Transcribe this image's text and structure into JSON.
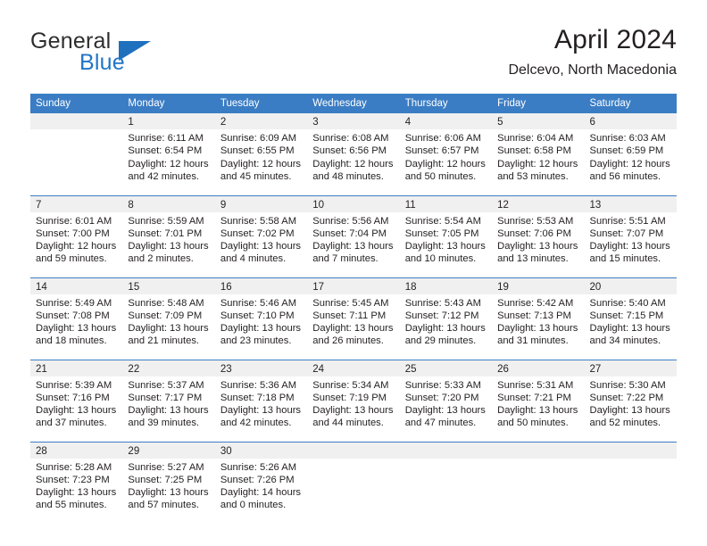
{
  "brand": {
    "name_part1": "General",
    "name_part2": "Blue",
    "triangle_icon": "triangle-icon",
    "colors": {
      "dark": "#2e2e2e",
      "blue": "#2176c7",
      "triangle": "#1f70bd"
    }
  },
  "header": {
    "title": "April 2024",
    "subtitle": "Delcevo, North Macedonia"
  },
  "theme": {
    "header_blue": "#3b7dc4",
    "daynum_band": "#f0f0f0",
    "text": "#231f20",
    "page_background": "#ffffff"
  },
  "calendar": {
    "weekday_headers": [
      "Sunday",
      "Monday",
      "Tuesday",
      "Wednesday",
      "Thursday",
      "Friday",
      "Saturday"
    ],
    "labels": {
      "sunrise": "Sunrise:",
      "sunset": "Sunset:",
      "daylight": "Daylight:"
    },
    "weeks": [
      [
        {
          "day": "",
          "sunrise": "",
          "sunset": "",
          "daylight_line1": "",
          "daylight_line2": ""
        },
        {
          "day": "1",
          "sunrise": "Sunrise: 6:11 AM",
          "sunset": "Sunset: 6:54 PM",
          "daylight_line1": "Daylight: 12 hours",
          "daylight_line2": "and 42 minutes."
        },
        {
          "day": "2",
          "sunrise": "Sunrise: 6:09 AM",
          "sunset": "Sunset: 6:55 PM",
          "daylight_line1": "Daylight: 12 hours",
          "daylight_line2": "and 45 minutes."
        },
        {
          "day": "3",
          "sunrise": "Sunrise: 6:08 AM",
          "sunset": "Sunset: 6:56 PM",
          "daylight_line1": "Daylight: 12 hours",
          "daylight_line2": "and 48 minutes."
        },
        {
          "day": "4",
          "sunrise": "Sunrise: 6:06 AM",
          "sunset": "Sunset: 6:57 PM",
          "daylight_line1": "Daylight: 12 hours",
          "daylight_line2": "and 50 minutes."
        },
        {
          "day": "5",
          "sunrise": "Sunrise: 6:04 AM",
          "sunset": "Sunset: 6:58 PM",
          "daylight_line1": "Daylight: 12 hours",
          "daylight_line2": "and 53 minutes."
        },
        {
          "day": "6",
          "sunrise": "Sunrise: 6:03 AM",
          "sunset": "Sunset: 6:59 PM",
          "daylight_line1": "Daylight: 12 hours",
          "daylight_line2": "and 56 minutes."
        }
      ],
      [
        {
          "day": "7",
          "sunrise": "Sunrise: 6:01 AM",
          "sunset": "Sunset: 7:00 PM",
          "daylight_line1": "Daylight: 12 hours",
          "daylight_line2": "and 59 minutes."
        },
        {
          "day": "8",
          "sunrise": "Sunrise: 5:59 AM",
          "sunset": "Sunset: 7:01 PM",
          "daylight_line1": "Daylight: 13 hours",
          "daylight_line2": "and 2 minutes."
        },
        {
          "day": "9",
          "sunrise": "Sunrise: 5:58 AM",
          "sunset": "Sunset: 7:02 PM",
          "daylight_line1": "Daylight: 13 hours",
          "daylight_line2": "and 4 minutes."
        },
        {
          "day": "10",
          "sunrise": "Sunrise: 5:56 AM",
          "sunset": "Sunset: 7:04 PM",
          "daylight_line1": "Daylight: 13 hours",
          "daylight_line2": "and 7 minutes."
        },
        {
          "day": "11",
          "sunrise": "Sunrise: 5:54 AM",
          "sunset": "Sunset: 7:05 PM",
          "daylight_line1": "Daylight: 13 hours",
          "daylight_line2": "and 10 minutes."
        },
        {
          "day": "12",
          "sunrise": "Sunrise: 5:53 AM",
          "sunset": "Sunset: 7:06 PM",
          "daylight_line1": "Daylight: 13 hours",
          "daylight_line2": "and 13 minutes."
        },
        {
          "day": "13",
          "sunrise": "Sunrise: 5:51 AM",
          "sunset": "Sunset: 7:07 PM",
          "daylight_line1": "Daylight: 13 hours",
          "daylight_line2": "and 15 minutes."
        }
      ],
      [
        {
          "day": "14",
          "sunrise": "Sunrise: 5:49 AM",
          "sunset": "Sunset: 7:08 PM",
          "daylight_line1": "Daylight: 13 hours",
          "daylight_line2": "and 18 minutes."
        },
        {
          "day": "15",
          "sunrise": "Sunrise: 5:48 AM",
          "sunset": "Sunset: 7:09 PM",
          "daylight_line1": "Daylight: 13 hours",
          "daylight_line2": "and 21 minutes."
        },
        {
          "day": "16",
          "sunrise": "Sunrise: 5:46 AM",
          "sunset": "Sunset: 7:10 PM",
          "daylight_line1": "Daylight: 13 hours",
          "daylight_line2": "and 23 minutes."
        },
        {
          "day": "17",
          "sunrise": "Sunrise: 5:45 AM",
          "sunset": "Sunset: 7:11 PM",
          "daylight_line1": "Daylight: 13 hours",
          "daylight_line2": "and 26 minutes."
        },
        {
          "day": "18",
          "sunrise": "Sunrise: 5:43 AM",
          "sunset": "Sunset: 7:12 PM",
          "daylight_line1": "Daylight: 13 hours",
          "daylight_line2": "and 29 minutes."
        },
        {
          "day": "19",
          "sunrise": "Sunrise: 5:42 AM",
          "sunset": "Sunset: 7:13 PM",
          "daylight_line1": "Daylight: 13 hours",
          "daylight_line2": "and 31 minutes."
        },
        {
          "day": "20",
          "sunrise": "Sunrise: 5:40 AM",
          "sunset": "Sunset: 7:15 PM",
          "daylight_line1": "Daylight: 13 hours",
          "daylight_line2": "and 34 minutes."
        }
      ],
      [
        {
          "day": "21",
          "sunrise": "Sunrise: 5:39 AM",
          "sunset": "Sunset: 7:16 PM",
          "daylight_line1": "Daylight: 13 hours",
          "daylight_line2": "and 37 minutes."
        },
        {
          "day": "22",
          "sunrise": "Sunrise: 5:37 AM",
          "sunset": "Sunset: 7:17 PM",
          "daylight_line1": "Daylight: 13 hours",
          "daylight_line2": "and 39 minutes."
        },
        {
          "day": "23",
          "sunrise": "Sunrise: 5:36 AM",
          "sunset": "Sunset: 7:18 PM",
          "daylight_line1": "Daylight: 13 hours",
          "daylight_line2": "and 42 minutes."
        },
        {
          "day": "24",
          "sunrise": "Sunrise: 5:34 AM",
          "sunset": "Sunset: 7:19 PM",
          "daylight_line1": "Daylight: 13 hours",
          "daylight_line2": "and 44 minutes."
        },
        {
          "day": "25",
          "sunrise": "Sunrise: 5:33 AM",
          "sunset": "Sunset: 7:20 PM",
          "daylight_line1": "Daylight: 13 hours",
          "daylight_line2": "and 47 minutes."
        },
        {
          "day": "26",
          "sunrise": "Sunrise: 5:31 AM",
          "sunset": "Sunset: 7:21 PM",
          "daylight_line1": "Daylight: 13 hours",
          "daylight_line2": "and 50 minutes."
        },
        {
          "day": "27",
          "sunrise": "Sunrise: 5:30 AM",
          "sunset": "Sunset: 7:22 PM",
          "daylight_line1": "Daylight: 13 hours",
          "daylight_line2": "and 52 minutes."
        }
      ],
      [
        {
          "day": "28",
          "sunrise": "Sunrise: 5:28 AM",
          "sunset": "Sunset: 7:23 PM",
          "daylight_line1": "Daylight: 13 hours",
          "daylight_line2": "and 55 minutes."
        },
        {
          "day": "29",
          "sunrise": "Sunrise: 5:27 AM",
          "sunset": "Sunset: 7:25 PM",
          "daylight_line1": "Daylight: 13 hours",
          "daylight_line2": "and 57 minutes."
        },
        {
          "day": "30",
          "sunrise": "Sunrise: 5:26 AM",
          "sunset": "Sunset: 7:26 PM",
          "daylight_line1": "Daylight: 14 hours",
          "daylight_line2": "and 0 minutes."
        },
        {
          "day": "",
          "sunrise": "",
          "sunset": "",
          "daylight_line1": "",
          "daylight_line2": ""
        },
        {
          "day": "",
          "sunrise": "",
          "sunset": "",
          "daylight_line1": "",
          "daylight_line2": ""
        },
        {
          "day": "",
          "sunrise": "",
          "sunset": "",
          "daylight_line1": "",
          "daylight_line2": ""
        },
        {
          "day": "",
          "sunrise": "",
          "sunset": "",
          "daylight_line1": "",
          "daylight_line2": ""
        }
      ]
    ]
  }
}
